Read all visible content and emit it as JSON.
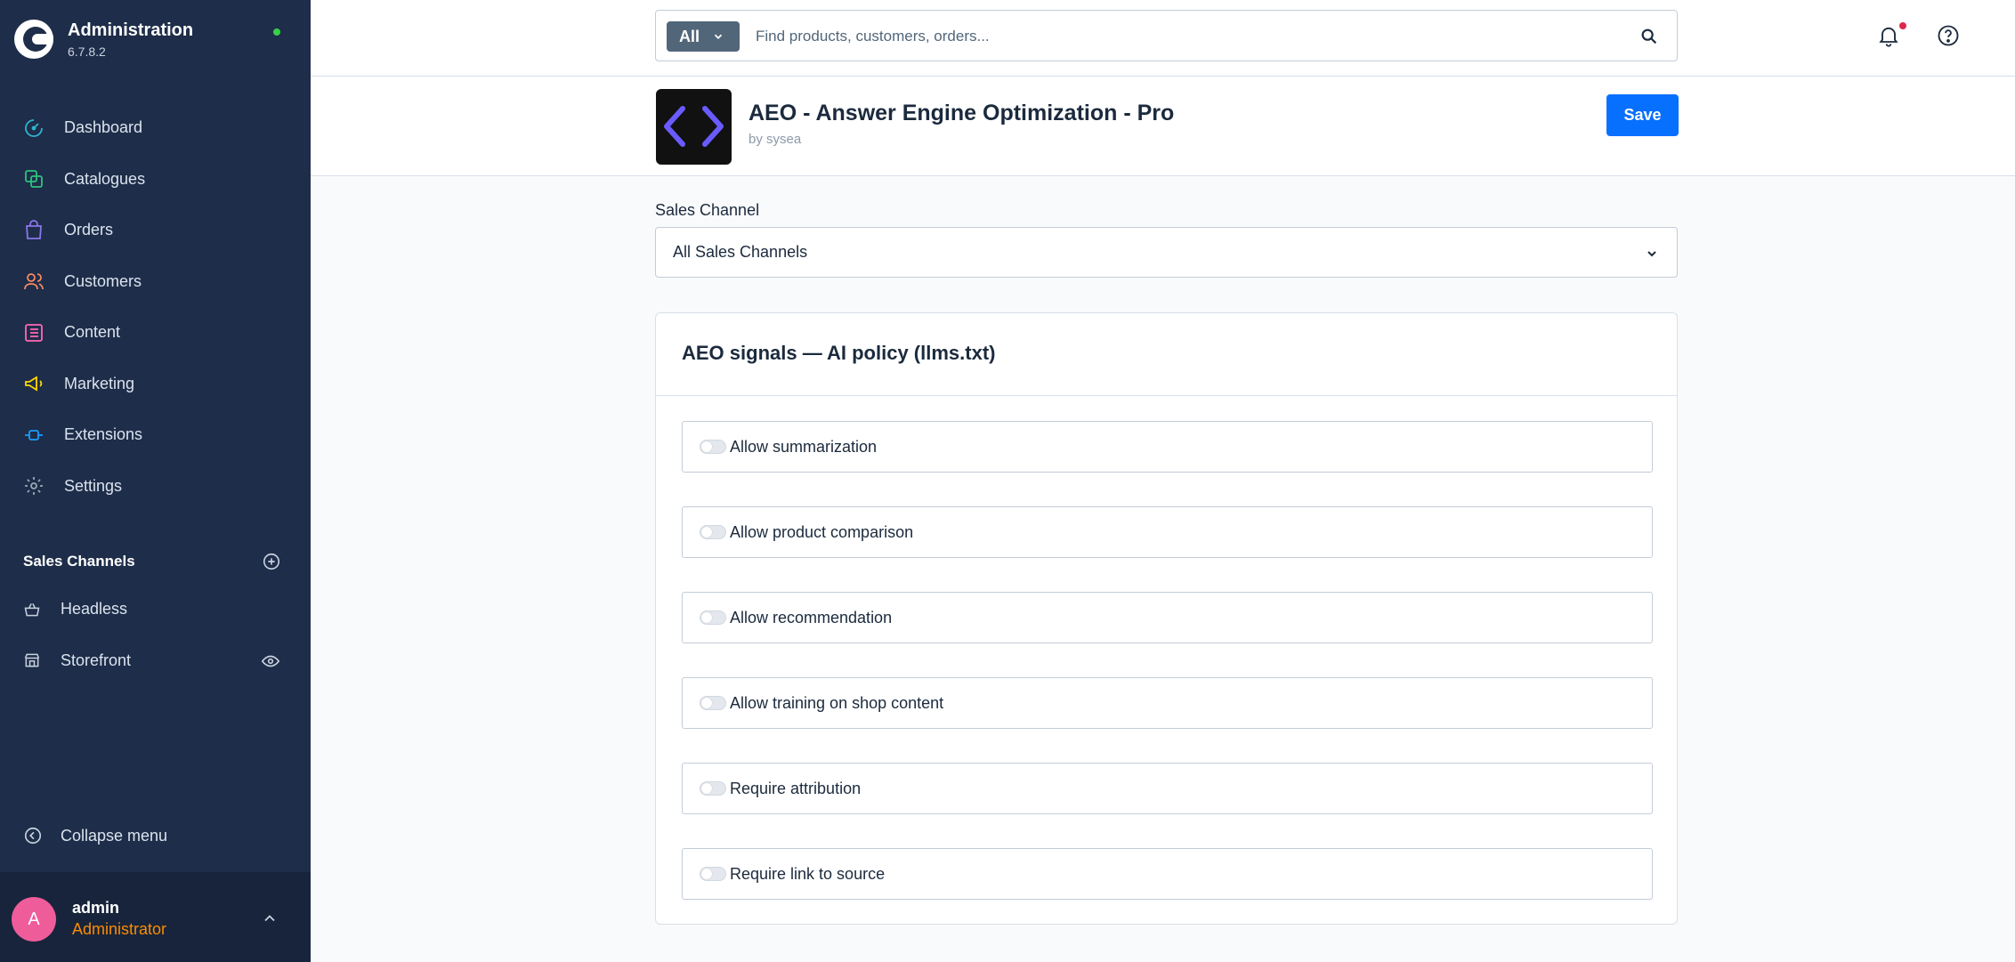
{
  "app": {
    "title": "Administration",
    "version": "6.7.8.2"
  },
  "nav": [
    {
      "label": "Dashboard",
      "icon": "dashboard-icon",
      "color": "#2fb3ce"
    },
    {
      "label": "Catalogues",
      "icon": "catalogues-icon",
      "color": "#2fc27f"
    },
    {
      "label": "Orders",
      "icon": "orders-icon",
      "color": "#8b76e8"
    },
    {
      "label": "Customers",
      "icon": "customers-icon",
      "color": "#f88962"
    },
    {
      "label": "Content",
      "icon": "content-icon",
      "color": "#ff68b4"
    },
    {
      "label": "Marketing",
      "icon": "marketing-icon",
      "color": "#ffd700"
    },
    {
      "label": "Extensions",
      "icon": "extensions-icon",
      "color": "#189eff"
    },
    {
      "label": "Settings",
      "icon": "settings-icon",
      "color": "#9aa8b5"
    }
  ],
  "sales_channels": {
    "title": "Sales Channels",
    "items": [
      {
        "label": "Headless",
        "icon": "basket-icon"
      },
      {
        "label": "Storefront",
        "icon": "storefront-icon"
      }
    ]
  },
  "collapse_label": "Collapse menu",
  "user": {
    "initial": "A",
    "name": "admin",
    "role": "Administrator"
  },
  "search": {
    "type": "All",
    "placeholder": "Find products, customers, orders..."
  },
  "plugin": {
    "name": "AEO - Answer Engine Optimization - Pro",
    "author": "by sysea",
    "save_label": "Save"
  },
  "sales_channel_field": {
    "label": "Sales Channel",
    "value": "All Sales Channels"
  },
  "card": {
    "title": "AEO signals — AI policy (llms.txt)",
    "options": [
      {
        "label": "Allow summarization",
        "enabled": false
      },
      {
        "label": "Allow product comparison",
        "enabled": false
      },
      {
        "label": "Allow recommendation",
        "enabled": false
      },
      {
        "label": "Allow training on shop content",
        "enabled": false
      },
      {
        "label": "Require attribution",
        "enabled": false
      },
      {
        "label": "Require link to source",
        "enabled": false
      }
    ]
  },
  "colors": {
    "sidebar": "#1e2d49",
    "accent": "#0870ff",
    "status_online": "#37d046",
    "role": "#fb8c00"
  }
}
